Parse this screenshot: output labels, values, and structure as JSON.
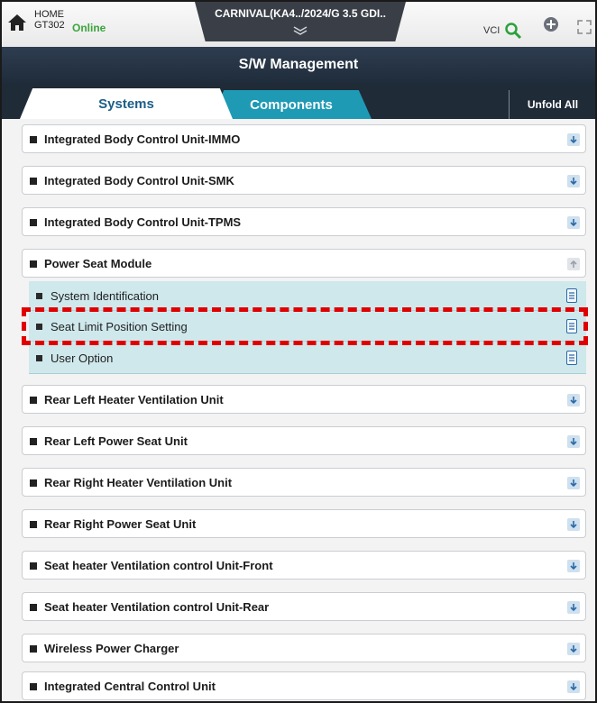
{
  "topbar": {
    "home_label": "HOME",
    "device": "GT302",
    "status": "Online",
    "vehicle": "CARNIVAL(KA4../2024/G 3.5 GDI..",
    "vci_label": "VCI"
  },
  "title": "S/W Management",
  "tabs": {
    "systems": "Systems",
    "components": "Components",
    "unfold_all": "Unfold All"
  },
  "systems": [
    {
      "label": "Integrated Body Control Unit-IMMO"
    },
    {
      "label": "Integrated Body Control Unit-SMK"
    },
    {
      "label": "Integrated Body Control Unit-TPMS"
    },
    {
      "label": "Power Seat Module",
      "expanded": true,
      "children": [
        {
          "label": "System Identification"
        },
        {
          "label": "Seat Limit Position Setting",
          "highlighted": true
        },
        {
          "label": "User Option"
        }
      ]
    },
    {
      "label": "Rear Left Heater Ventilation Unit"
    },
    {
      "label": "Rear Left Power Seat Unit"
    },
    {
      "label": "Rear Right Heater Ventilation Unit"
    },
    {
      "label": "Rear Right Power Seat Unit"
    },
    {
      "label": "Seat heater Ventilation control Unit-Front"
    },
    {
      "label": "Seat heater Ventilation control Unit-Rear"
    },
    {
      "label": "Wireless Power Charger"
    },
    {
      "label": "Integrated Central Control Unit"
    }
  ],
  "colors": {
    "accent_teal": "#1f9ab5",
    "header_dark": "#1f2c3b",
    "online_green": "#3aa53a",
    "highlight_red": "#e00000",
    "child_bg": "#cfe8ec"
  }
}
